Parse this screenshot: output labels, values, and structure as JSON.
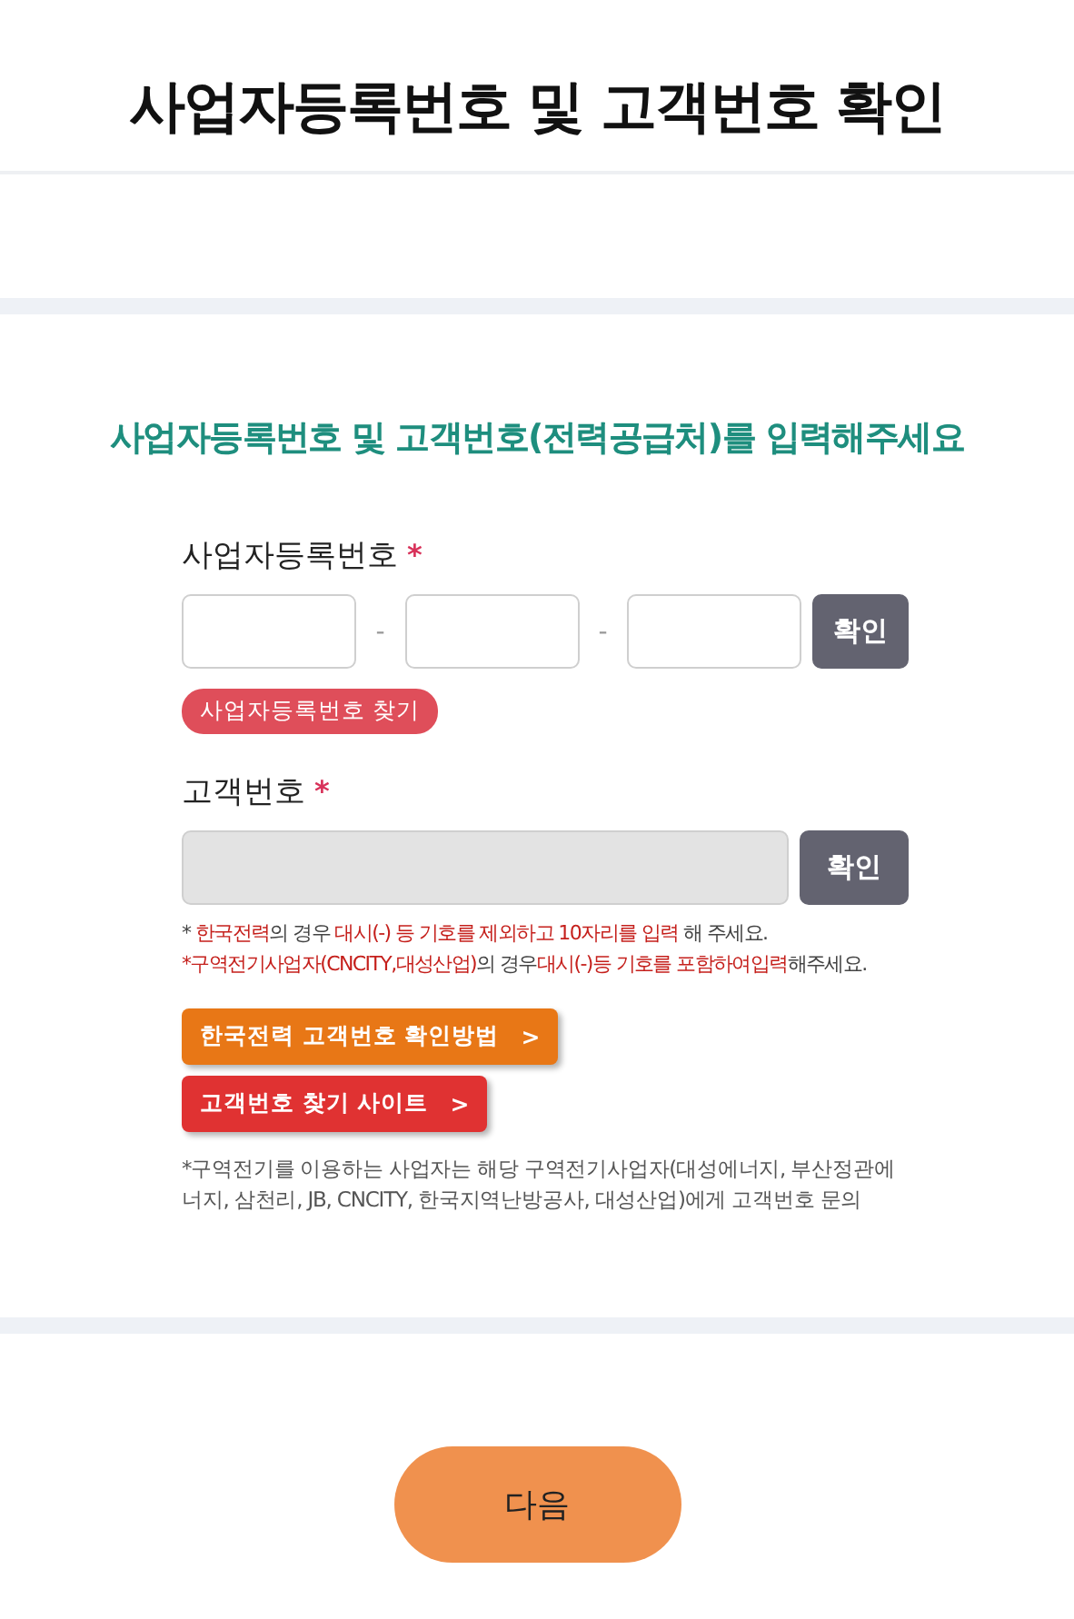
{
  "header": {
    "title": "사업자등록번호 및 고객번호 확인"
  },
  "form": {
    "heading": "사업자등록번호 및 고객번호(전력공급처)를 입력해주세요",
    "business_number": {
      "label": "사업자등록번호",
      "required_mark": "*",
      "separators": [
        "-",
        "-"
      ],
      "confirm_button": "확인",
      "find_button": "사업자등록번호 찾기"
    },
    "customer_number": {
      "label": "고객번호",
      "required_mark": "*",
      "disabled": true,
      "confirm_button": "확인",
      "notes": [
        "* **한국전력**의 경우 **대시(-) 등 기호를 제외하고 10자리를 입력** 해 주세요.",
        "***구역전기사업자(CNCITY,대성산업)**의 경우**대시(-)등 기호를 포함하여입력**해주세요."
      ]
    },
    "link_buttons": [
      {
        "label": "한국전력 고객번호 확인방법",
        "arrow": ">",
        "color": "#e87716"
      },
      {
        "label": "고객번호 찾기 사이트",
        "arrow": ">",
        "color": "#e03232"
      }
    ],
    "footnote": "*구역전기를 이용하는 사업자는 해당 구역전기사업자(대성에너지, 부산정관에너지, 삼천리, JB, CNCITY, 한국지역난방공사, 대성산업)에게 고객번호 문의"
  },
  "next_button": "다음"
}
